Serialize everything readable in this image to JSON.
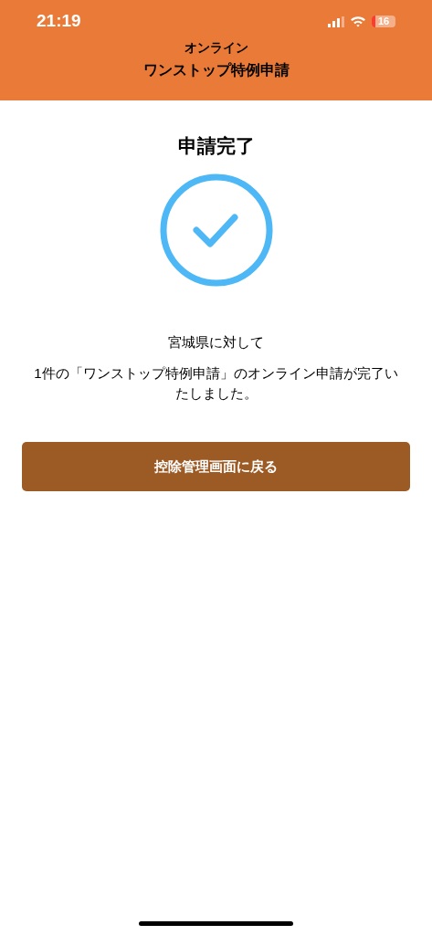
{
  "status_bar": {
    "time": "21:19",
    "battery": "16"
  },
  "header": {
    "subtitle": "オンライン",
    "title": "ワンストップ特例申請"
  },
  "heading": "申請完了",
  "message": {
    "line_1": "宮城県に対して",
    "line_2": "1件の「ワンストップ特例申請」のオンライン申請が完了いたしました。"
  },
  "button": "控除管理画面に戻る"
}
